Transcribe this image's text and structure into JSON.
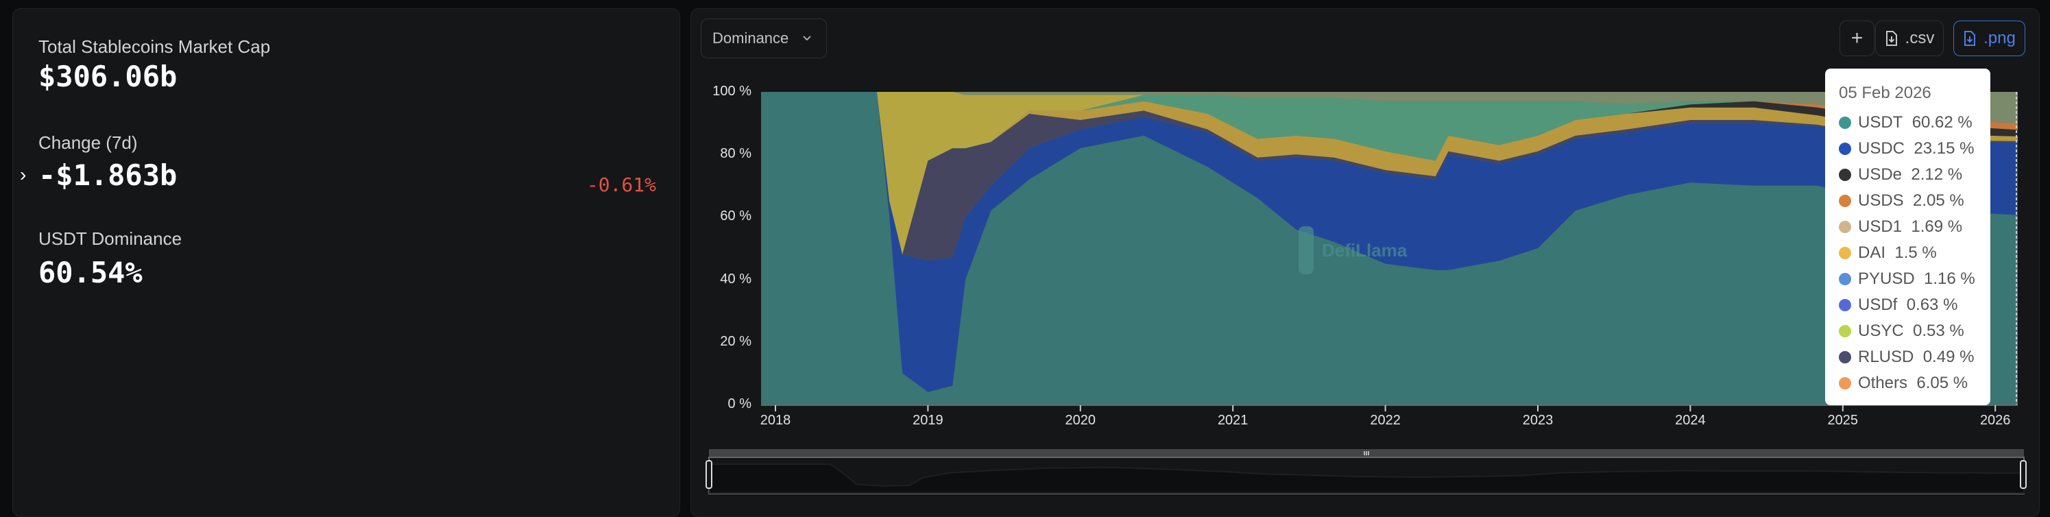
{
  "summary": {
    "market_cap_label": "Total Stablecoins Market Cap",
    "market_cap_value": "$306.06b",
    "change_label": "Change (7d)",
    "change_value": "-$1.863b",
    "change_percent": "-0.61%",
    "dominance_label": "USDT Dominance",
    "dominance_value": "60.54%",
    "negative_color": "#e0533f"
  },
  "toolbar": {
    "view_select": "Dominance",
    "add_label": "+",
    "csv_label": ".csv",
    "png_label": ".png",
    "icons": {
      "view": "chevron-down-icon",
      "add": "plus-icon",
      "csv": "file-download-icon",
      "png": "file-download-icon"
    },
    "accent": "#3b6fd6"
  },
  "watermark": "DefiLlama",
  "tooltip": {
    "date": "05 Feb 2026",
    "rows": [
      {
        "name": "USDT",
        "value": "60.62 %",
        "color": "#3d9690"
      },
      {
        "name": "USDC",
        "value": "23.15 %",
        "color": "#2451b8"
      },
      {
        "name": "USDe",
        "value": "2.12 %",
        "color": "#333333"
      },
      {
        "name": "USDS",
        "value": "2.05 %",
        "color": "#d9803a"
      },
      {
        "name": "USD1",
        "value": "1.69 %",
        "color": "#d2b48c"
      },
      {
        "name": "DAI",
        "value": "1.5 %",
        "color": "#ecb84a"
      },
      {
        "name": "PYUSD",
        "value": "1.16 %",
        "color": "#5a8fdc"
      },
      {
        "name": "USDf",
        "value": "0.63 %",
        "color": "#5569d6"
      },
      {
        "name": "USYC",
        "value": "0.53 %",
        "color": "#bcd44e"
      },
      {
        "name": "RLUSD",
        "value": "0.49 %",
        "color": "#4c4c6c"
      },
      {
        "name": "Others",
        "value": "6.05 %",
        "color": "#f09a58"
      }
    ]
  },
  "chart_data": {
    "type": "area",
    "stacked": "percent",
    "ylim": [
      0,
      100
    ],
    "yticks": [
      "0 %",
      "20 %",
      "40 %",
      "60 %",
      "80 %",
      "100 %"
    ],
    "xticks": [
      "2018",
      "2019",
      "2020",
      "2021",
      "2022",
      "2023",
      "2024",
      "2025",
      "2026"
    ],
    "grid": false,
    "x": [
      "2017-12-01",
      "2018-09-01",
      "2018-10-01",
      "2018-11-01",
      "2019-01-01",
      "2019-03-01",
      "2019-04-01",
      "2019-06-01",
      "2019-09-01",
      "2020-01-01",
      "2020-06-01",
      "2020-11-01",
      "2021-03-01",
      "2021-06-01",
      "2021-09-01",
      "2022-01-01",
      "2022-05-01",
      "2022-06-01",
      "2022-10-01",
      "2023-01-01",
      "2023-04-01",
      "2023-08-01",
      "2024-01-01",
      "2024-06-01",
      "2024-11-01",
      "2025-03-01",
      "2025-08-01",
      "2026-02-05"
    ],
    "series": [
      {
        "name": "USDT",
        "color": "#3a7674",
        "values": [
          100,
          100,
          60,
          10,
          4,
          6,
          40,
          62,
          72,
          82,
          86,
          76,
          66,
          56,
          52,
          45,
          43,
          43,
          46,
          50,
          62,
          67,
          71,
          70,
          70,
          66,
          62,
          60.62
        ]
      },
      {
        "name": "USDC",
        "color": "#22479a",
        "values": [
          0,
          0,
          5,
          38,
          42,
          41,
          20,
          8,
          10,
          6,
          6,
          11,
          12,
          23,
          26,
          29,
          29,
          37,
          31,
          30,
          23,
          20,
          19,
          20,
          19,
          20,
          22,
          23.15
        ]
      },
      {
        "color": "#454560",
        "values": [
          0,
          0,
          0,
          0,
          32,
          35,
          22,
          14,
          11,
          3,
          2,
          1,
          1,
          1,
          1,
          1,
          1,
          1,
          1,
          1,
          1,
          1,
          1,
          1,
          0.5,
          0.5,
          0.5,
          0.49
        ]
      },
      {
        "name": "DAI",
        "color": "#b8993f",
        "values": [
          0,
          0,
          0,
          0,
          0,
          0,
          0,
          0,
          1,
          3,
          3,
          5,
          6,
          6,
          6,
          6,
          5,
          5,
          5,
          5,
          5,
          5,
          4,
          4,
          3,
          3,
          2,
          1.5
        ]
      },
      {
        "name": "USDe",
        "color": "#2e2e30",
        "values": [
          0,
          0,
          0,
          0,
          0,
          0,
          0,
          0,
          0,
          0,
          0,
          0,
          0,
          0,
          0,
          0,
          0,
          0,
          0,
          0,
          0,
          0,
          1,
          2,
          2.5,
          3,
          3,
          2.12
        ]
      },
      {
        "name": "USDS",
        "color": "#c8783a",
        "values": [
          0,
          0,
          0,
          0,
          0,
          0,
          0,
          0,
          0,
          0,
          0,
          0,
          0,
          0,
          0,
          0,
          0,
          0,
          0,
          0,
          0,
          0,
          0,
          0,
          1,
          1.5,
          2,
          2.05
        ]
      },
      {
        "color": "#52977a",
        "values": [
          0,
          0,
          0,
          0,
          0,
          0,
          0,
          0,
          0,
          0,
          2,
          6,
          13,
          12,
          13,
          16,
          19,
          11,
          14,
          11,
          6,
          3,
          1,
          0,
          0,
          0,
          0,
          0
        ]
      },
      {
        "color": "#b5a642",
        "values": [
          0,
          0,
          35,
          52,
          22,
          18,
          17,
          15,
          5,
          5,
          0,
          0,
          0,
          0,
          0,
          0,
          0,
          0,
          0,
          0,
          0,
          0,
          0,
          0,
          0,
          0,
          0,
          0
        ]
      },
      {
        "color": "#7a8a6a",
        "values": [
          0,
          0,
          0,
          0,
          0,
          0,
          1,
          1,
          1,
          1,
          1,
          1,
          2,
          2,
          2,
          3,
          3,
          3,
          3,
          3,
          3,
          4,
          3,
          3,
          4,
          6,
          8.5,
          10.07
        ]
      }
    ]
  }
}
